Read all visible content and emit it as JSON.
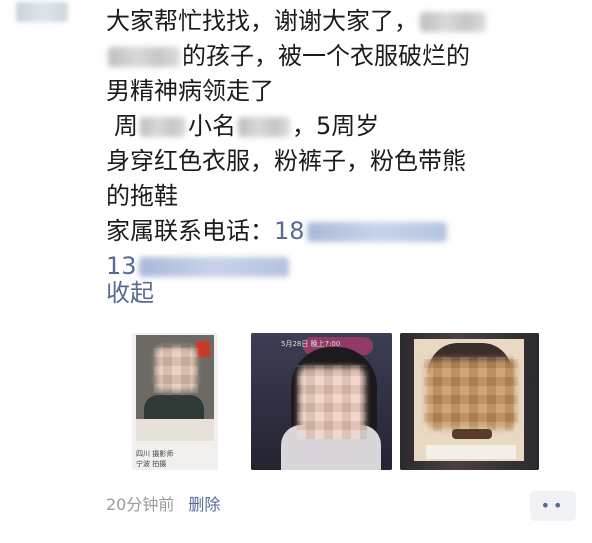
{
  "post": {
    "line1": "大家帮忙找找，谢谢大家了，",
    "line2_suffix": "的孩子，被一个衣服破烂的",
    "line3": "男精神病领走了",
    "line4_prefix": "周",
    "line4_mid": "小名",
    "line4_suffix": "，5周岁",
    "line5": "身穿红色衣服，粉裤子，粉色带熊",
    "line6": "的拖鞋",
    "contact_label": "家属联系电话：",
    "phone1_visible": "18",
    "phone2_visible": "13"
  },
  "collapse_label": "收起",
  "photos": {
    "photo1_caption": "四川 摄影师",
    "photo1_caption2": "宁波 拍摄",
    "photo2_stamp": "5月28日 晚上7:00"
  },
  "meta": {
    "time": "20分钟前",
    "delete_label": "删除",
    "more_icon": "more-dots-icon",
    "more_glyph": "••"
  },
  "colors": {
    "link": "#576b95",
    "text": "#1b1b1b",
    "meta": "#9a9a9a"
  }
}
